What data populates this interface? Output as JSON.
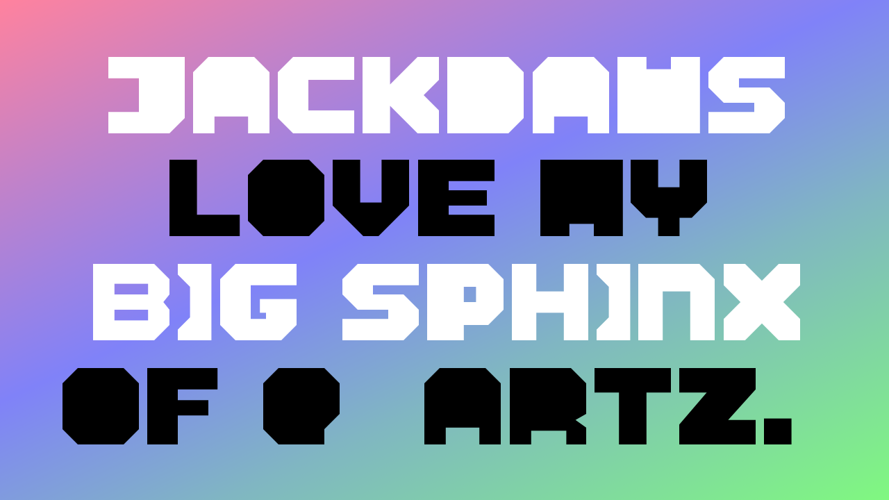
{
  "colors": {
    "gradient": [
      "#ff829e",
      "#bd82cc",
      "#8082f8",
      "#80b6c2",
      "#80f880"
    ],
    "line_fills": [
      "#ffffff",
      "#000000",
      "#ffffff",
      "#000000"
    ]
  },
  "poster": {
    "lines": [
      "JACKDAWS",
      "LOVE MY",
      "BIG SPHINX",
      "OF QUARTZ."
    ]
  }
}
